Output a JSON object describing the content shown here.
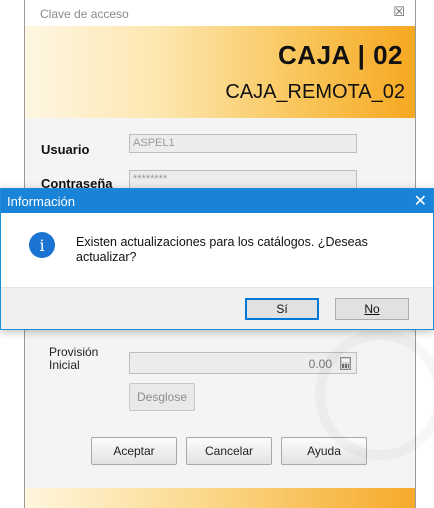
{
  "login": {
    "title": "Clave de acceso",
    "close_glyph": "☒",
    "banner": {
      "caja": "CAJA | 02",
      "remota": "CAJA_REMOTA_02"
    },
    "usuario_label": "Usuario",
    "usuario_value": "ASPEL1",
    "contrasena_label": "Contraseña",
    "contrasena_value": "********",
    "provision_label_line1": "Provisión",
    "provision_label_line2": "Inicial",
    "provision_value": "0.00",
    "desglose_label": "Desglose",
    "aceptar_label": "Aceptar",
    "cancelar_label": "Cancelar",
    "ayuda_label": "Ayuda"
  },
  "message_box": {
    "title": "Información",
    "close_glyph": "✕",
    "icon_glyph": "i",
    "message": "Existen actualizaciones para los catálogos. ¿Deseas actualizar?",
    "yes_label": "Sí",
    "no_label": "No",
    "accent_color": "#1883d7"
  }
}
